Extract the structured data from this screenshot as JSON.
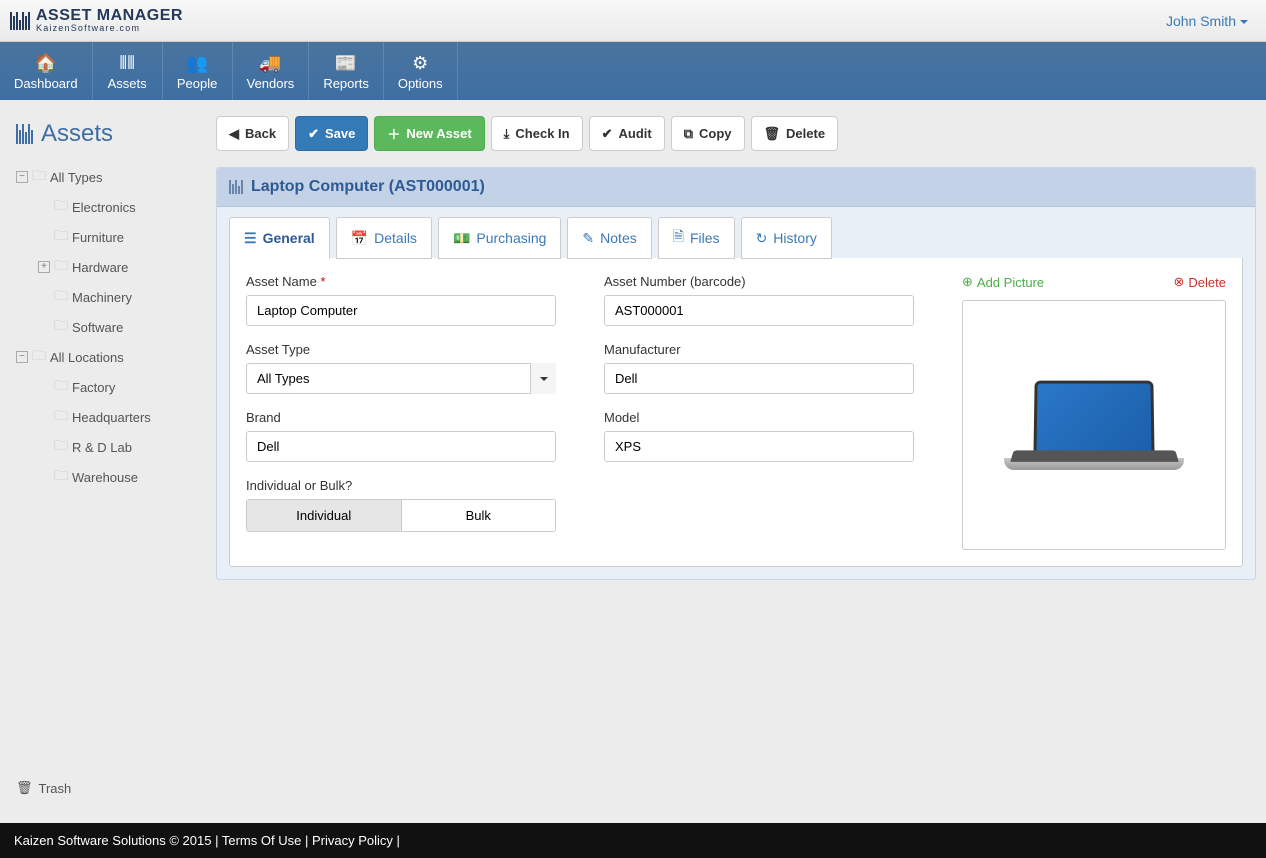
{
  "brand": {
    "title": "ASSET MANAGER",
    "subtitle": "KaizenSoftware.com"
  },
  "user_name": "John Smith",
  "nav": [
    {
      "label": "Dashboard",
      "icon": "🏠"
    },
    {
      "label": "Assets",
      "icon": "⦀⦀"
    },
    {
      "label": "People",
      "icon": "👥"
    },
    {
      "label": "Vendors",
      "icon": "🚚"
    },
    {
      "label": "Reports",
      "icon": "📰"
    },
    {
      "label": "Options",
      "icon": "⚙"
    }
  ],
  "sidebar": {
    "title": "Assets",
    "tree_types": {
      "root": "All Types",
      "children": [
        "Electronics",
        "Furniture",
        "Hardware",
        "Machinery",
        "Software"
      ]
    },
    "tree_locations": {
      "root": "All Locations",
      "children": [
        "Factory",
        "Headquarters",
        "R & D Lab",
        "Warehouse"
      ]
    },
    "trash": "Trash"
  },
  "toolbar": {
    "back": "Back",
    "save": "Save",
    "new_asset": "New Asset",
    "check_in": "Check In",
    "audit": "Audit",
    "copy": "Copy",
    "delete": "Delete"
  },
  "panel": {
    "title": "Laptop Computer (AST000001)"
  },
  "tabs": [
    "General",
    "Details",
    "Purchasing",
    "Notes",
    "Files",
    "History"
  ],
  "form": {
    "asset_name_label": "Asset Name",
    "asset_name": "Laptop Computer",
    "asset_number_label": "Asset Number (barcode)",
    "asset_number": "AST000001",
    "asset_type_label": "Asset Type",
    "asset_type": "All Types",
    "manufacturer_label": "Manufacturer",
    "manufacturer": "Dell",
    "brand_label": "Brand",
    "brand": "Dell",
    "model_label": "Model",
    "model": "XPS",
    "ib_label": "Individual or Bulk?",
    "ib_individual": "Individual",
    "ib_bulk": "Bulk"
  },
  "picture": {
    "add": "Add Picture",
    "delete": "Delete"
  },
  "footer": {
    "copyright": "Kaizen Software Solutions © 2015",
    "terms": "Terms Of Use",
    "privacy": "Privacy Policy"
  }
}
